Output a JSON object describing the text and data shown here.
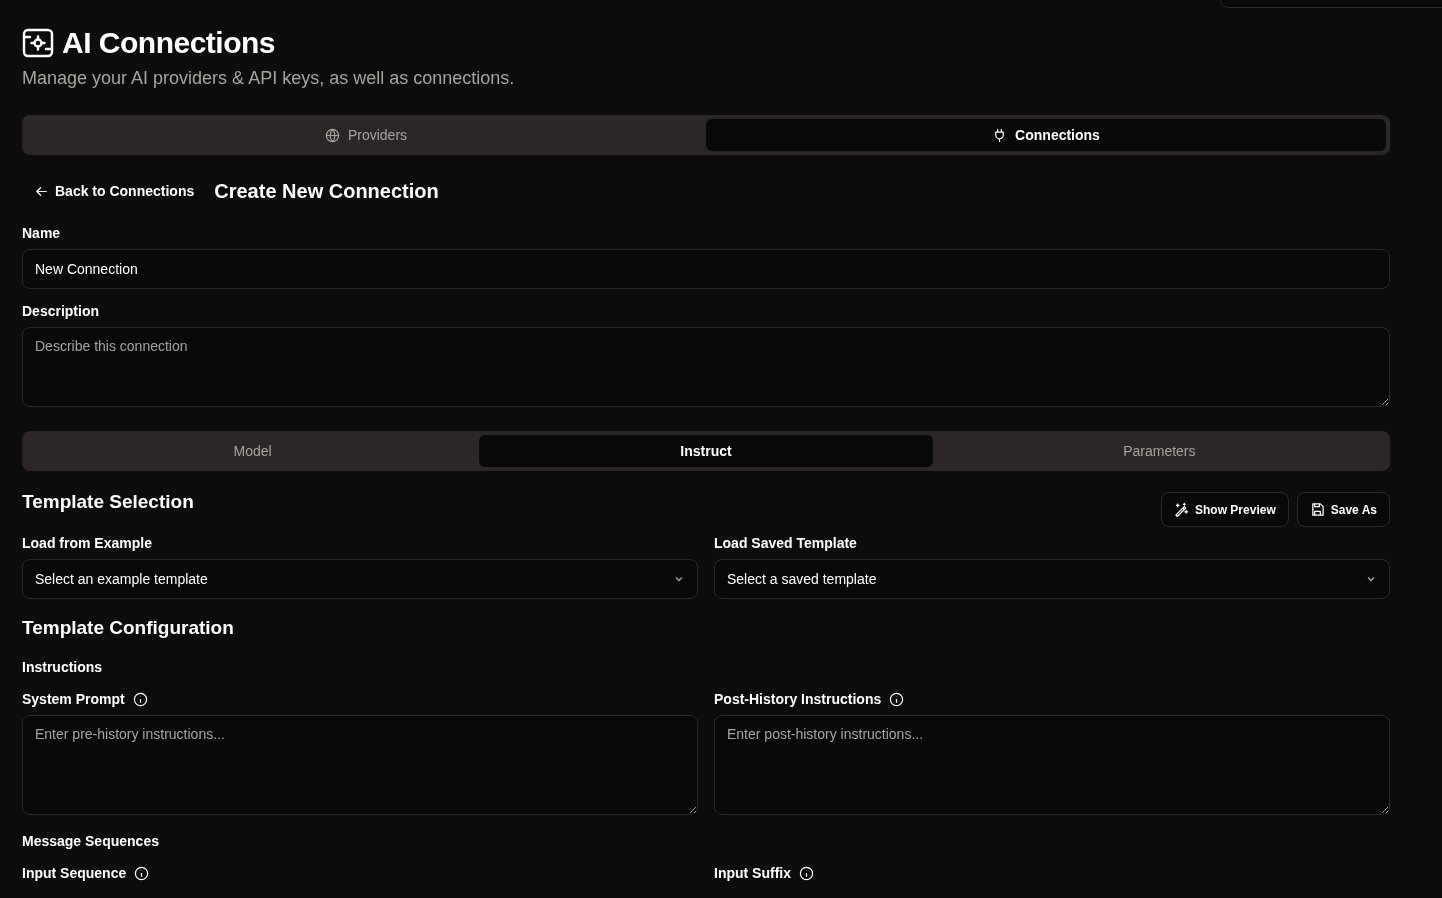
{
  "header": {
    "title": "AI Connections",
    "subtitle": "Manage your AI providers & API keys, as well as connections."
  },
  "main_tabs": [
    {
      "label": "Providers",
      "selected": false
    },
    {
      "label": "Connections",
      "selected": true
    }
  ],
  "back_link": "Back to Connections",
  "page_title": "Create New Connection",
  "name_field": {
    "label": "Name",
    "value": "New Connection"
  },
  "description_field": {
    "label": "Description",
    "placeholder": "Describe this connection"
  },
  "section_tabs": [
    {
      "label": "Model",
      "selected": false
    },
    {
      "label": "Instruct",
      "selected": true
    },
    {
      "label": "Parameters",
      "selected": false
    }
  ],
  "template_selection": {
    "title": "Template Selection",
    "buttons": [
      {
        "label": "Show Preview"
      },
      {
        "label": "Save As"
      }
    ],
    "selects": [
      {
        "label": "Load from Example",
        "placeholder": "Select an example template"
      },
      {
        "label": "Load Saved Template",
        "placeholder": "Select a saved template"
      }
    ]
  },
  "template_configuration": {
    "title": "Template Configuration",
    "instructions_heading": "Instructions",
    "instruction_fields": [
      {
        "label": "System Prompt",
        "placeholder": "Enter pre-history instructions..."
      },
      {
        "label": "Post-History Instructions",
        "placeholder": "Enter post-history instructions..."
      }
    ],
    "sequences_heading": "Message Sequences",
    "sequence_labels": [
      "Input Sequence",
      "Input Suffix"
    ]
  }
}
